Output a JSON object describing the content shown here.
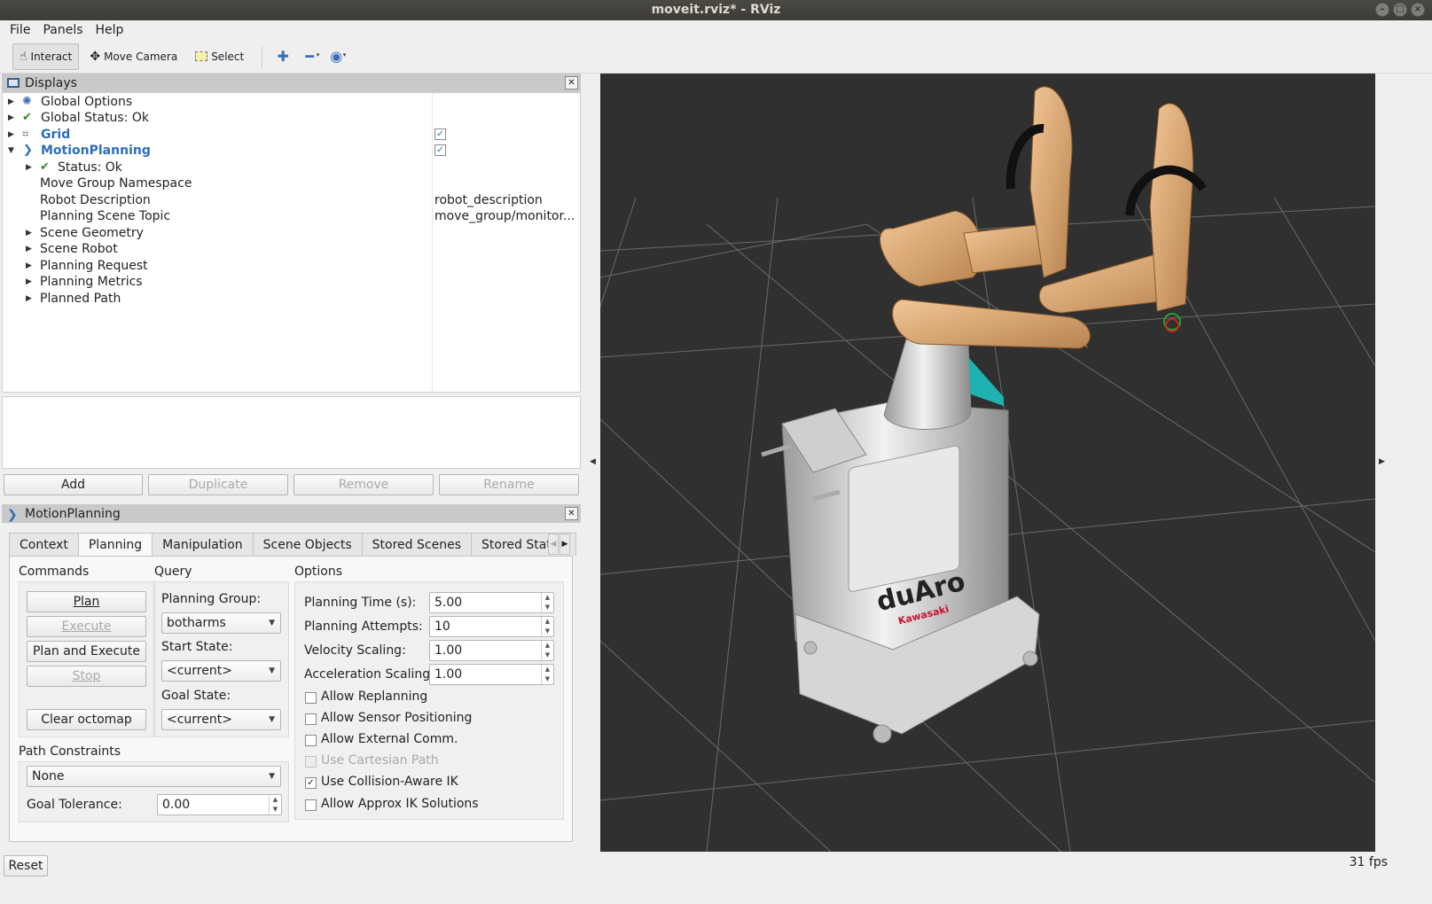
{
  "window": {
    "title": "moveit.rviz* - RViz"
  },
  "menu": {
    "items": [
      "File",
      "Panels",
      "Help"
    ]
  },
  "toolbar": {
    "interact": "Interact",
    "move_camera": "Move Camera",
    "select": "Select"
  },
  "displays": {
    "title": "Displays",
    "items": [
      {
        "label": "Global Options"
      },
      {
        "label": "Global Status: Ok"
      },
      {
        "label": "Grid",
        "checked": true
      },
      {
        "label": "MotionPlanning",
        "checked": true
      },
      {
        "label": "Status: Ok"
      },
      {
        "label": "Move Group Namespace"
      },
      {
        "label": "Robot Description",
        "value": "robot_description"
      },
      {
        "label": "Planning Scene Topic",
        "value": "move_group/monitor..."
      },
      {
        "label": "Scene Geometry"
      },
      {
        "label": "Scene Robot"
      },
      {
        "label": "Planning Request"
      },
      {
        "label": "Planning Metrics"
      },
      {
        "label": "Planned Path"
      }
    ],
    "buttons": {
      "add": "Add",
      "duplicate": "Duplicate",
      "remove": "Remove",
      "rename": "Rename"
    }
  },
  "motion_planning": {
    "title": "MotionPlanning",
    "tabs": [
      "Context",
      "Planning",
      "Manipulation",
      "Scene Objects",
      "Stored Scenes",
      "Stored States"
    ],
    "selected_tab": "Planning",
    "commands": {
      "title": "Commands",
      "plan": "Plan",
      "execute": "Execute",
      "plan_and_execute": "Plan and Execute",
      "stop": "Stop",
      "clear_octomap": "Clear octomap"
    },
    "query": {
      "title": "Query",
      "planning_group_label": "Planning Group:",
      "planning_group": "botharms",
      "start_state_label": "Start State:",
      "start_state": "<current>",
      "goal_state_label": "Goal State:",
      "goal_state": "<current>"
    },
    "options": {
      "title": "Options",
      "planning_time_label": "Planning Time (s):",
      "planning_time": "5.00",
      "planning_attempts_label": "Planning Attempts:",
      "planning_attempts": "10",
      "velocity_scaling_label": "Velocity Scaling:",
      "velocity_scaling": "1.00",
      "acceleration_scaling_label": "Acceleration Scaling:",
      "acceleration_scaling": "1.00",
      "checkboxes": [
        {
          "label": "Allow Replanning",
          "checked": false,
          "enabled": true
        },
        {
          "label": "Allow Sensor Positioning",
          "checked": false,
          "enabled": true
        },
        {
          "label": "Allow External Comm.",
          "checked": false,
          "enabled": true
        },
        {
          "label": "Use Cartesian Path",
          "checked": false,
          "enabled": false
        },
        {
          "label": "Use Collision-Aware IK",
          "checked": true,
          "enabled": true
        },
        {
          "label": "Allow Approx IK Solutions",
          "checked": false,
          "enabled": true
        }
      ]
    },
    "path_constraints": {
      "title": "Path Constraints",
      "value": "None",
      "goal_tolerance_label": "Goal Tolerance:",
      "goal_tolerance": "0.00"
    }
  },
  "viewport": {
    "background": "#303030",
    "robot_logo": "duAro",
    "robot_brand": "Kawasaki"
  },
  "status": {
    "reset": "Reset",
    "fps": "31 fps"
  }
}
